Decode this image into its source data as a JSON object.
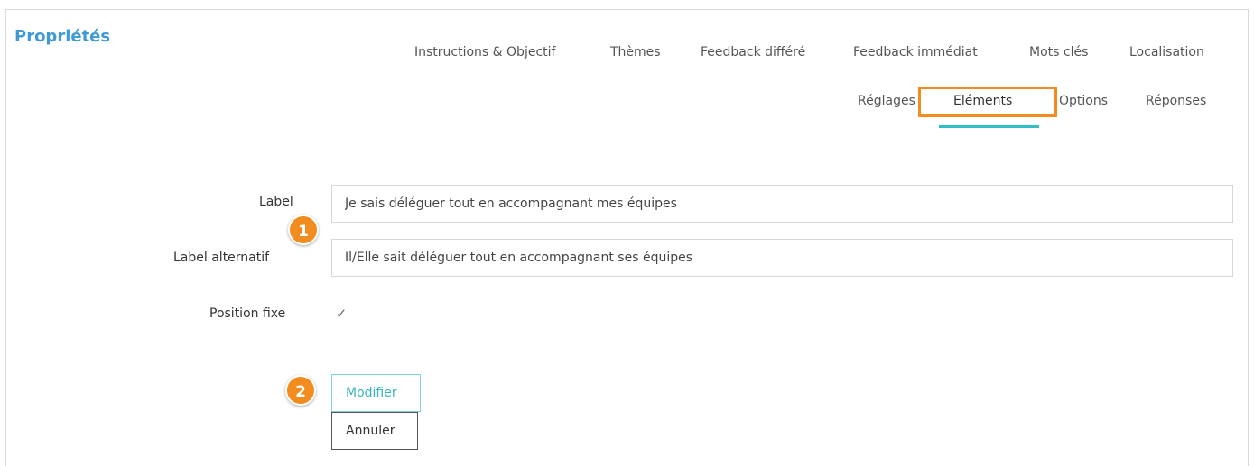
{
  "header": {
    "title": "Propriétés"
  },
  "tabs_row1": [
    {
      "label": "Instructions & Objectif"
    },
    {
      "label": "Thèmes"
    },
    {
      "label": "Feedback différé"
    },
    {
      "label": "Feedback immédiat"
    },
    {
      "label": "Mots clés"
    },
    {
      "label": "Localisation"
    }
  ],
  "tabs_row2": [
    {
      "label": "Réglages"
    },
    {
      "label": "Eléments",
      "active": true
    },
    {
      "label": "Options"
    },
    {
      "label": "Réponses"
    }
  ],
  "form": {
    "label_field": {
      "label": "Label",
      "value": "Je sais déléguer tout en accompagnant mes équipes"
    },
    "alt_label_field": {
      "label": "Label alternatif",
      "value": "Il/Elle sait déléguer tout en accompagnant ses équipes"
    },
    "position_fixe": {
      "label": "Position fixe",
      "checked": true,
      "mark": "✓"
    }
  },
  "buttons": {
    "modify": "Modifier",
    "cancel": "Annuler"
  },
  "callouts": {
    "one": "1",
    "two": "2"
  },
  "colors": {
    "accent": "#3d9ad6",
    "highlight": "#f28c1e",
    "active_tab": "#2fbfc4"
  }
}
